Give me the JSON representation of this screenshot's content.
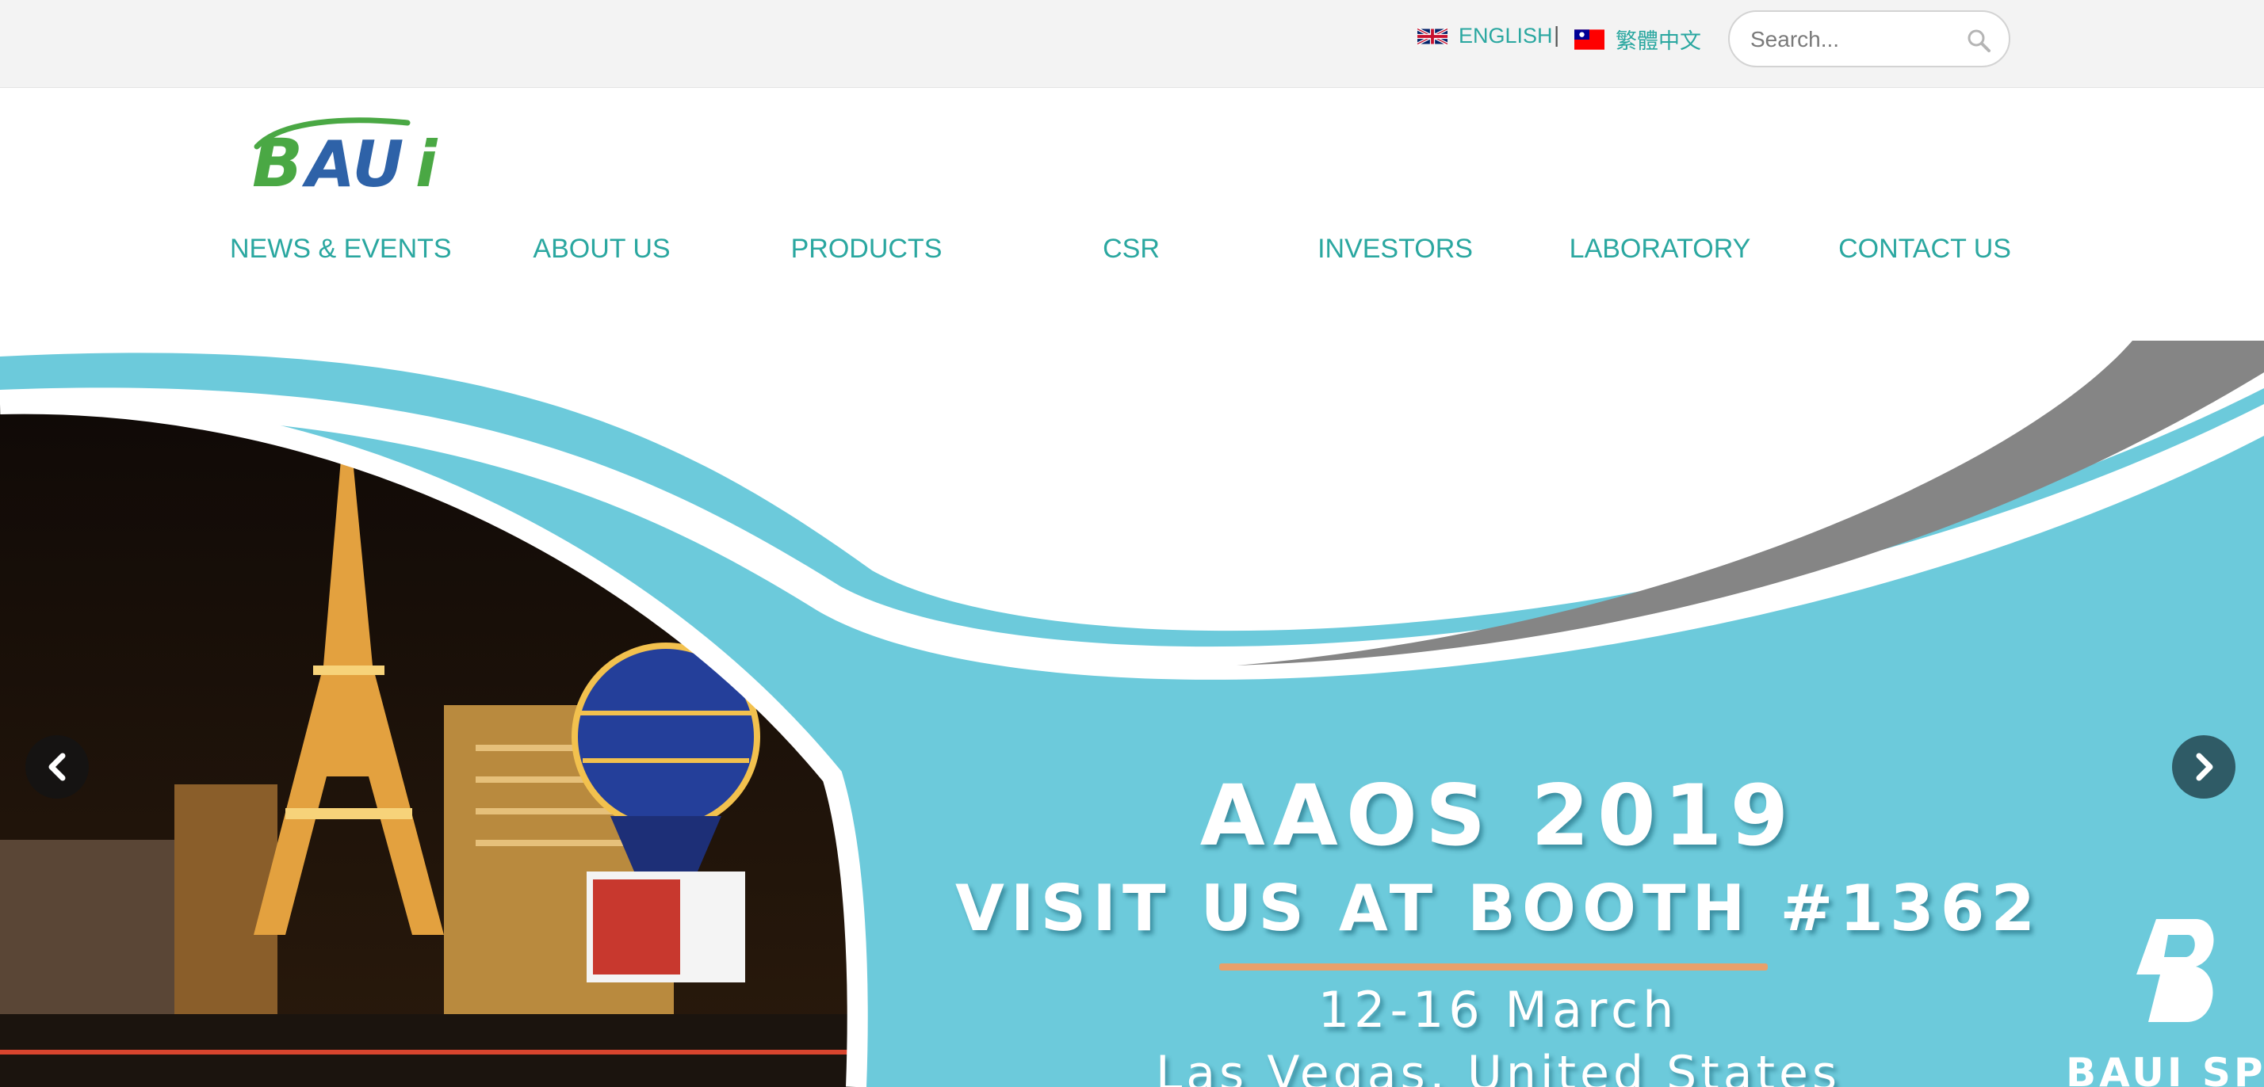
{
  "topbar": {
    "lang_english": "ENGLISH",
    "lang_separator": "|",
    "lang_chinese": "繁體中文",
    "search_placeholder": "Search..."
  },
  "header": {
    "logo_text": "BAUi",
    "nav": [
      {
        "label": "NEWS & EVENTS"
      },
      {
        "label": "ABOUT US"
      },
      {
        "label": "PRODUCTS"
      },
      {
        "label": "CSR"
      },
      {
        "label": "INVESTORS"
      },
      {
        "label": "LABORATORY"
      },
      {
        "label": "CONTACT US"
      }
    ]
  },
  "hero": {
    "headline": "AAOS 2019",
    "subheadline": "VISIT US AT BOOTH  #1362",
    "date": "12-16 March",
    "location": "Las Vegas, United States",
    "brand_text": "BAUI SPINE"
  },
  "icons": {
    "search": "search-icon",
    "prev": "chevron-left-icon",
    "next": "chevron-right-icon"
  },
  "colors": {
    "accent": "#2aa7a0",
    "banner": "#6ccadb",
    "rule": "#e8a06b",
    "logo_green": "#4aa844",
    "logo_blue": "#2e62a8"
  }
}
